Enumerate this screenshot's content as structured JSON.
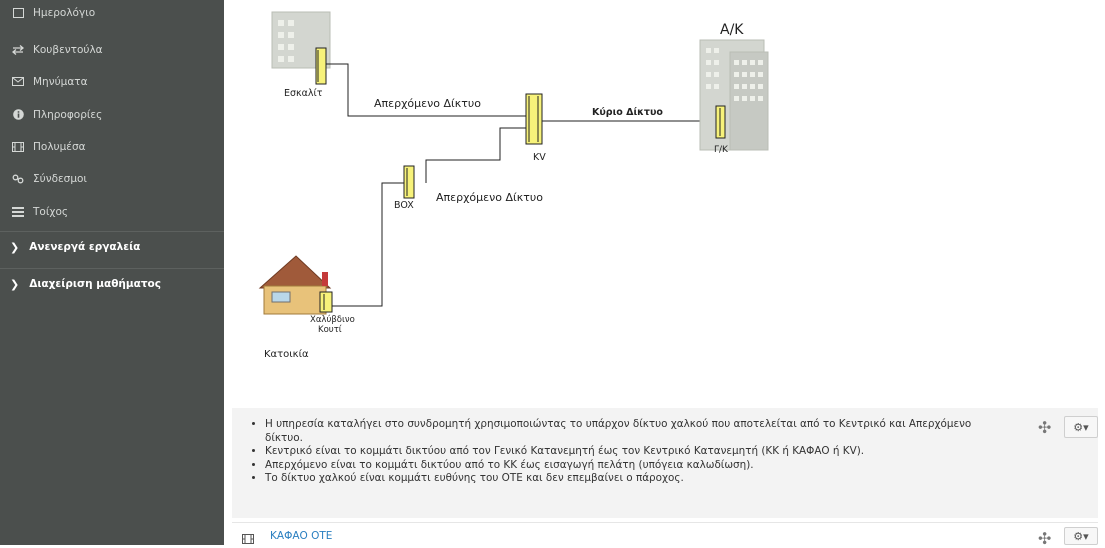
{
  "sidebar": {
    "items": [
      {
        "label": "Ημερολόγιο",
        "icon": "calendar-icon"
      },
      {
        "label": "Κουβεντούλα",
        "icon": "exchange-icon"
      },
      {
        "label": "Μηνύματα",
        "icon": "envelope-icon"
      },
      {
        "label": "Πληροφορίες",
        "icon": "info-icon"
      },
      {
        "label": "Πολυμέσα",
        "icon": "film-icon"
      },
      {
        "label": "Σύνδεσμοι",
        "icon": "link-icon"
      },
      {
        "label": "Τοίχος",
        "icon": "list-icon"
      }
    ],
    "sections": [
      {
        "label": "Ανενεργά εργαλεία",
        "icon": "chevron-right-icon"
      },
      {
        "label": "Διαχείριση μαθήματος",
        "icon": "chevron-right-icon"
      }
    ]
  },
  "diagram": {
    "label_ak": "Α/Κ",
    "label_eskalit": "Εσκαλίτ",
    "label_aperx1": "Απερχόμενο Δίκτυο",
    "label_kyrio": "Κύριο Δίκτυο",
    "label_kv": "KV",
    "label_gk": "Γ/Κ",
    "label_box": "BOX",
    "label_aperx2": "Απερχόμενο Δίκτυο",
    "label_xalyb1": "Χαλύβδινο",
    "label_xalyb2": "Κουτί",
    "label_katoikia": "Κατοικία"
  },
  "info": {
    "bullets": [
      "Η υπηρεσία καταλήγει στο συνδρομητή χρησιμοποιώντας το υπάρχον δίκτυο χαλκού που αποτελείται από το Κεντρικό και Απερχόμενο δίκτυο.",
      "Κεντρικό είναι το κομμάτι δικτύου από τον Γενικό Κατανεμητή έως τον Κεντρικό Κατανεμητή (ΚΚ ή ΚΑΦΑΟ ή KV).",
      "Απερχόμενο είναι το κομμάτι δικτύου από το ΚΚ έως εισαγωγή πελάτη (υπόγεια καλωδίωση).",
      "Το δίκτυο χαλκού είναι κομμάτι ευθύνης του ΟΤΕ και δεν επεμβαίνει ο πάροχος."
    ]
  },
  "resource": {
    "link_label": "ΚΑΦΑΟ ΟΤΕ",
    "icon": "film-icon"
  },
  "controls": {
    "move_glyph": "✣",
    "gear_glyph": "⚙▾"
  }
}
